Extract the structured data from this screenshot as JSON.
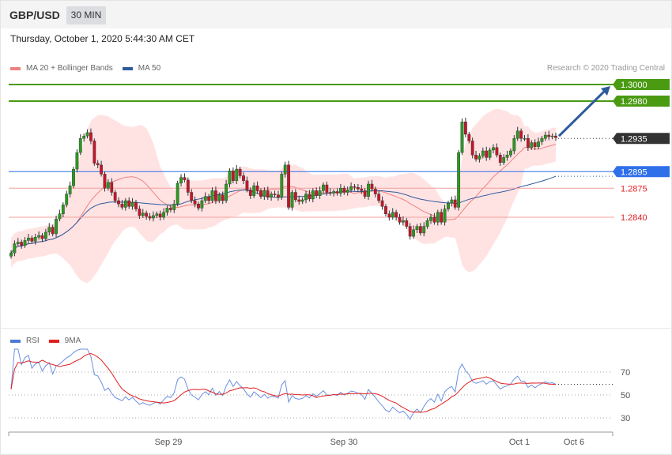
{
  "header": {
    "symbol": "GBP/USD",
    "timeframe": "30 MIN"
  },
  "datetime": "Thursday, October 1, 2020 5:44:30 AM CET",
  "copyright": "Research © 2020 Trading Central",
  "legend_main": [
    {
      "label": "MA 20 + Bollinger Bands",
      "color": "#f08080"
    },
    {
      "label": "MA 50",
      "color": "#2e5a9c"
    }
  ],
  "legend_rsi": [
    {
      "label": "RSI",
      "color": "#4a7ad6"
    },
    {
      "label": "9MA",
      "color": "#e02020"
    }
  ],
  "chart_data": {
    "type": "candlestick",
    "price_range": [
      1.2795,
      1.3005
    ],
    "levels": [
      {
        "value": 1.3,
        "label": "1.3000",
        "kind": "resistance",
        "color": "#4a9a12"
      },
      {
        "value": 1.298,
        "label": "1.2980",
        "kind": "resistance",
        "color": "#4a9a12"
      },
      {
        "value": 1.2935,
        "label": "1.2935",
        "kind": "last-price",
        "color": "#333333"
      },
      {
        "value": 1.2895,
        "label": "1.2895",
        "kind": "pivot",
        "color": "#2f6fea"
      },
      {
        "value": 1.2875,
        "label": "1.2875",
        "kind": "support",
        "color": "#e02020"
      },
      {
        "value": 1.284,
        "label": "1.2840",
        "kind": "support",
        "color": "#e02020"
      }
    ],
    "x_labels": [
      "Sep 29",
      "Sep 30",
      "Oct 1",
      "Oct 6"
    ],
    "candles_close": [
      1.2797,
      1.2808,
      1.281,
      1.2806,
      1.2812,
      1.2815,
      1.2811,
      1.2816,
      1.2818,
      1.2814,
      1.2822,
      1.2828,
      1.282,
      1.2838,
      1.2844,
      1.2855,
      1.2868,
      1.2878,
      1.2898,
      1.2918,
      1.2935,
      1.2938,
      1.2942,
      1.2932,
      1.2905,
      1.2903,
      1.2892,
      1.2875,
      1.2882,
      1.287,
      1.286,
      1.2856,
      1.2852,
      1.286,
      1.2853,
      1.2858,
      1.285,
      1.2842,
      1.2845,
      1.2841,
      1.2839,
      1.2842,
      1.2844,
      1.284,
      1.2846,
      1.2851,
      1.2849,
      1.2856,
      1.2881,
      1.2888,
      1.2885,
      1.287,
      1.286,
      1.2856,
      1.2851,
      1.286,
      1.2865,
      1.286,
      1.2872,
      1.286,
      1.2867,
      1.286,
      1.288,
      1.2896,
      1.2884,
      1.2898,
      1.289,
      1.2884,
      1.2873,
      1.2866,
      1.2878,
      1.2872,
      1.2865,
      1.2872,
      1.2864,
      1.2868,
      1.2867,
      1.2864,
      1.2892,
      1.2903,
      1.2852,
      1.287,
      1.2861,
      1.2859,
      1.2861,
      1.2868,
      1.2862,
      1.2872,
      1.2866,
      1.2872,
      1.2879,
      1.287,
      1.2869,
      1.2871,
      1.2869,
      1.2875,
      1.287,
      1.2873,
      1.2877,
      1.2876,
      1.2874,
      1.2872,
      1.2865,
      1.288,
      1.2874,
      1.2868,
      1.286,
      1.2853,
      1.2844,
      1.284,
      1.2846,
      1.284,
      1.2834,
      1.2836,
      1.2829,
      1.2817,
      1.2825,
      1.2829,
      1.2821,
      1.2829,
      1.2836,
      1.284,
      1.2834,
      1.2846,
      1.2834,
      1.285,
      1.2857,
      1.2861,
      1.2852,
      1.2918,
      1.2955,
      1.294,
      1.2932,
      1.2915,
      1.291,
      1.2914,
      1.292,
      1.2912,
      1.2921,
      1.2924,
      1.2915,
      1.2906,
      1.2912,
      1.2915,
      1.292,
      1.2935,
      1.2944,
      1.2935,
      1.2935,
      1.2924,
      1.293,
      1.2925,
      1.2931,
      1.2935,
      1.2939,
      1.2937,
      1.2938,
      1.2936
    ],
    "rsi": {
      "ticks": [
        70,
        50,
        30
      ],
      "overbought": 70,
      "oversold": 30,
      "last_rsi": 65,
      "last_9ma": 63
    }
  }
}
